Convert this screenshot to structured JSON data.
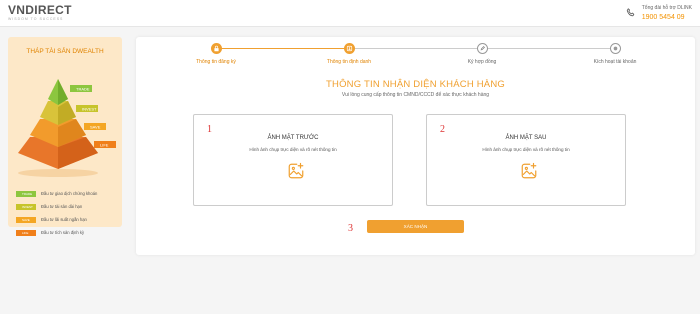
{
  "header": {
    "logo_main": "VNDIRECT",
    "logo_sub": "WISDOM TO SUCCESS",
    "support_label": "Tổng đài hỗ trợ DLINK",
    "support_phone": "1900 5454 09",
    "icon": "phone-icon"
  },
  "sidebar": {
    "title": "THÁP TÀI SẢN DWEALTH",
    "pyramid_tags": [
      "TRADE",
      "INVEST",
      "SAVE",
      "LIFE"
    ],
    "legend": [
      {
        "tag": "TRADE",
        "text": "Đầu tư giao dịch chứng khoán"
      },
      {
        "tag": "INVEST",
        "text": "Đầu tư tài sản dài hạn"
      },
      {
        "tag": "SAVE",
        "text": "Đầu tư lãi suất ngắn hạn"
      },
      {
        "tag": "LIFE",
        "text": "Đầu tư tích sản định kỳ"
      }
    ],
    "colors": {
      "trade": "#8dc63f",
      "invest": "#c7c42b",
      "save": "#f4a623",
      "life": "#f07f1a"
    }
  },
  "steps": [
    {
      "label": "Thông tin đăng ký",
      "state": "done",
      "icon": "lock-icon"
    },
    {
      "label": "Thông tin định danh",
      "state": "current",
      "icon": "id-icon"
    },
    {
      "label": "Ký hợp đồng",
      "state": "todo",
      "icon": "pen-icon"
    },
    {
      "label": "Kích hoạt tài khoản",
      "state": "todo",
      "icon": "check-icon"
    }
  ],
  "main": {
    "title": "THÔNG TIN NHẬN DIỆN KHÁCH HÀNG",
    "subtitle": "Vui lòng cung cấp thông tin CMND/CCCD để xác thực khách hàng",
    "front": {
      "num": "1",
      "title": "ẢNH MẶT TRƯỚC",
      "desc": "Hình ảnh chụp trực diện và rõ nét thông tin",
      "icon": "image-add-icon"
    },
    "back": {
      "num": "2",
      "title": "ẢNH MẶT SAU",
      "desc": "Hình ảnh chụp trực diện và rõ nét thông tin",
      "icon": "image-add-icon"
    },
    "confirm_num": "3",
    "confirm_label": "XÁC NHẬN"
  },
  "accent": "#f0a030"
}
